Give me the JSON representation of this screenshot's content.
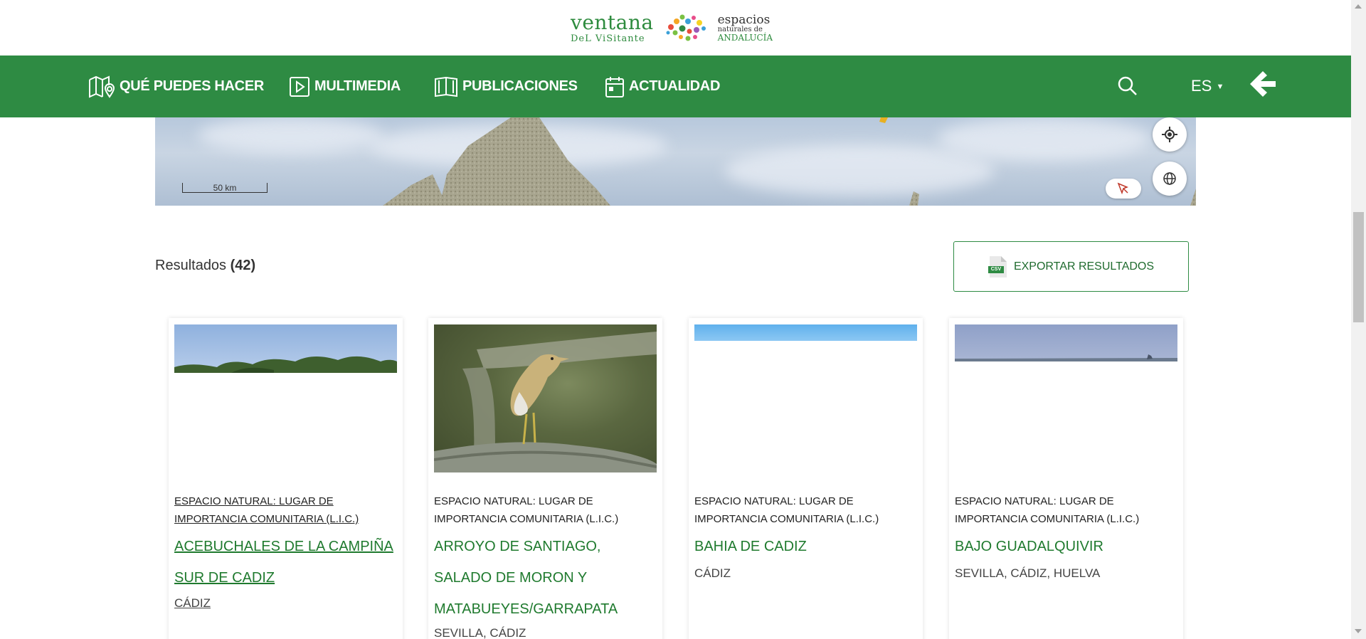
{
  "logo": {
    "line1": "ventana",
    "line2": "DeL ViSitante",
    "esp1": "espacios",
    "esp2": "naturales de",
    "esp3": "ANDALUCÍA"
  },
  "nav": {
    "items": [
      {
        "label": "QUÉ PUEDES HACER",
        "icon": "map-pin-icon"
      },
      {
        "label": "MULTIMEDIA",
        "icon": "play-icon"
      },
      {
        "label": "PUBLICACIONES",
        "icon": "book-icon"
      },
      {
        "label": "ACTUALIDAD",
        "icon": "calendar-icon"
      }
    ],
    "language": "ES"
  },
  "map": {
    "scale_label": "50 km"
  },
  "results": {
    "label": "Resultados",
    "count": "(42)",
    "export_label": "EXPORTAR RESULTADOS",
    "export_icon_text": "CSV"
  },
  "cards": [
    {
      "category": "ESPACIO NATURAL: LUGAR DE IMPORTANCIA COMUNITARIA (L.I.C.)",
      "title": "ACEBUCHALES DE LA CAMPIÑA SUR DE CADIZ",
      "location": "CÁDIZ"
    },
    {
      "category": "ESPACIO NATURAL: LUGAR DE IMPORTANCIA COMUNITARIA (L.I.C.)",
      "title": "ARROYO DE SANTIAGO, SALADO DE MORON Y MATABUEYES/GARRAPATA",
      "location": "SEVILLA, CÁDIZ"
    },
    {
      "category": "ESPACIO NATURAL: LUGAR DE IMPORTANCIA COMUNITARIA (L.I.C.)",
      "title": "BAHIA DE CADIZ",
      "location": "CÁDIZ"
    },
    {
      "category": "ESPACIO NATURAL: LUGAR DE IMPORTANCIA COMUNITARIA (L.I.C.)",
      "title": "BAJO GUADALQUIVIR",
      "location": "SEVILLA, CÁDIZ, HUELVA"
    }
  ],
  "colors": {
    "brand_green": "#2e8b43",
    "title_green": "#1f7a2e"
  }
}
